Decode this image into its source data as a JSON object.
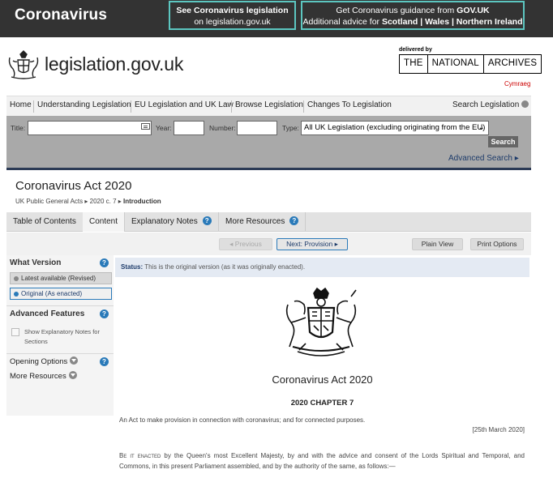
{
  "banner": {
    "title": "Coronavirus",
    "box1_line1": "See Coronavirus legislation",
    "box1_line2": "on legislation.gov.uk",
    "box2_line1_pre": "Get Coronavirus guidance from ",
    "box2_line1_bold": "GOV.UK",
    "box2_line2_pre": "Additional advice for ",
    "box2_line2_bold": "Scotland | Wales | Northern Ireland"
  },
  "header": {
    "site_name": "legislation.gov.uk",
    "delivered_by": "delivered by",
    "tna": [
      "THE",
      "NATIONAL",
      "ARCHIVES"
    ],
    "cymraeg": "Cymraeg"
  },
  "mainnav": {
    "items": [
      "Home",
      "Understanding Legislation",
      "EU Legislation and UK Law",
      "Browse Legislation",
      "Changes To Legislation"
    ],
    "search_link": "Search Legislation"
  },
  "search": {
    "title_label": "Title:",
    "title_value": "",
    "year_label": "Year:",
    "year_value": "",
    "number_label": "Number:",
    "number_value": "",
    "type_label": "Type:",
    "type_value": "All UK Legislation (excluding originating from the EU)",
    "search_button": "Search",
    "advanced": "Advanced Search ▸"
  },
  "title_area": {
    "title": "Coronavirus Act 2020",
    "crumbs": [
      "UK Public General Acts",
      "2020 c. 7",
      "Introduction"
    ]
  },
  "tabs": [
    "Table of Contents",
    "Content",
    "Explanatory Notes",
    "More Resources"
  ],
  "pager": {
    "previous": "Previous",
    "next": "Next: Provision",
    "plain_view": "Plain View",
    "print_options": "Print Options"
  },
  "sidebar": {
    "what_version": "What Version",
    "latest": "Latest available (Revised)",
    "original": "Original (As enacted)",
    "advanced_features": "Advanced Features",
    "show_notes": "Show Explanatory Notes for Sections",
    "opening_options": "Opening Options",
    "more_resources": "More Resources"
  },
  "content": {
    "status_label": "Status:",
    "status_text": "This is the original version (as it was originally enacted).",
    "title": "Coronavirus Act 2020",
    "chapter": "2020 CHAPTER 7",
    "long_title": "An Act to make provision in connection with coronavirus; and for connected purposes.",
    "date": "[25th March 2020]",
    "enact_sc": "Be it enacted",
    "enact_rest": " by the Queen's most Excellent Majesty, by and with the advice and consent of the Lords Spiritual and Temporal, and Commons, in this present Parliament assembled, and by the authority of the same, as follows:—"
  }
}
